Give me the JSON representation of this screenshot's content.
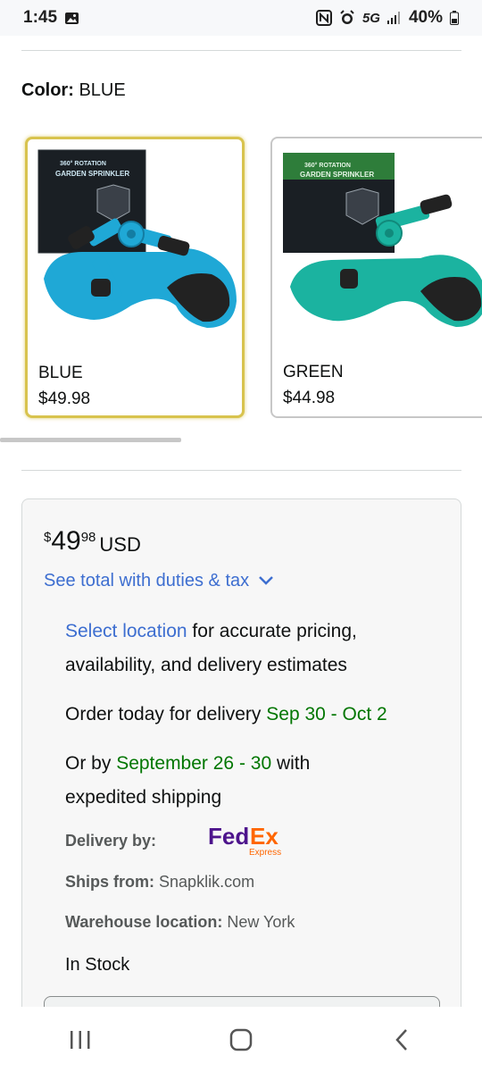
{
  "status_bar": {
    "time": "1:45",
    "network": "5G",
    "battery": "40%"
  },
  "color_selector": {
    "label": "Color:",
    "selected_value": "BLUE",
    "variants": [
      {
        "name": "BLUE",
        "price": "$49.98",
        "selected": true,
        "box_title": "360° ROTATION GARDEN SPRINKLER",
        "color": "#1fa8d6"
      },
      {
        "name": "GREEN",
        "price": "$44.98",
        "selected": false,
        "box_title": "360° ROTATION GARDEN SPRINKLER",
        "color": "#1bb3a0"
      }
    ]
  },
  "buy_box": {
    "price": {
      "symbol": "$",
      "whole": "49",
      "fraction": "98",
      "currency": "USD"
    },
    "duties_link": "See total with duties & tax",
    "location": {
      "link": "Select location",
      "text_line1": " for accurate pricing,",
      "text_line2": "availability, and delivery estimates"
    },
    "delivery": {
      "prefix": "Order today for delivery ",
      "dates": "Sep 30 - Oct 2"
    },
    "expedited": {
      "prefix": "Or by ",
      "dates": "September 26 - 30",
      "suffix": " with",
      "line2": "expedited shipping"
    },
    "delivery_by_label": "Delivery by:",
    "carrier": {
      "fed": "Fed",
      "ex": "Ex",
      "sub": "Express"
    },
    "ships_from_label": "Ships from:",
    "ships_from_value": "Snapklik.com",
    "warehouse_label": "Warehouse location:",
    "warehouse_value": "New York",
    "stock": "In Stock"
  },
  "colors": {
    "link": "#3d6ed0",
    "green": "#007600",
    "selected_border": "#d8c34e",
    "fedex_purple": "#4d148c",
    "fedex_orange": "#ff6600"
  }
}
